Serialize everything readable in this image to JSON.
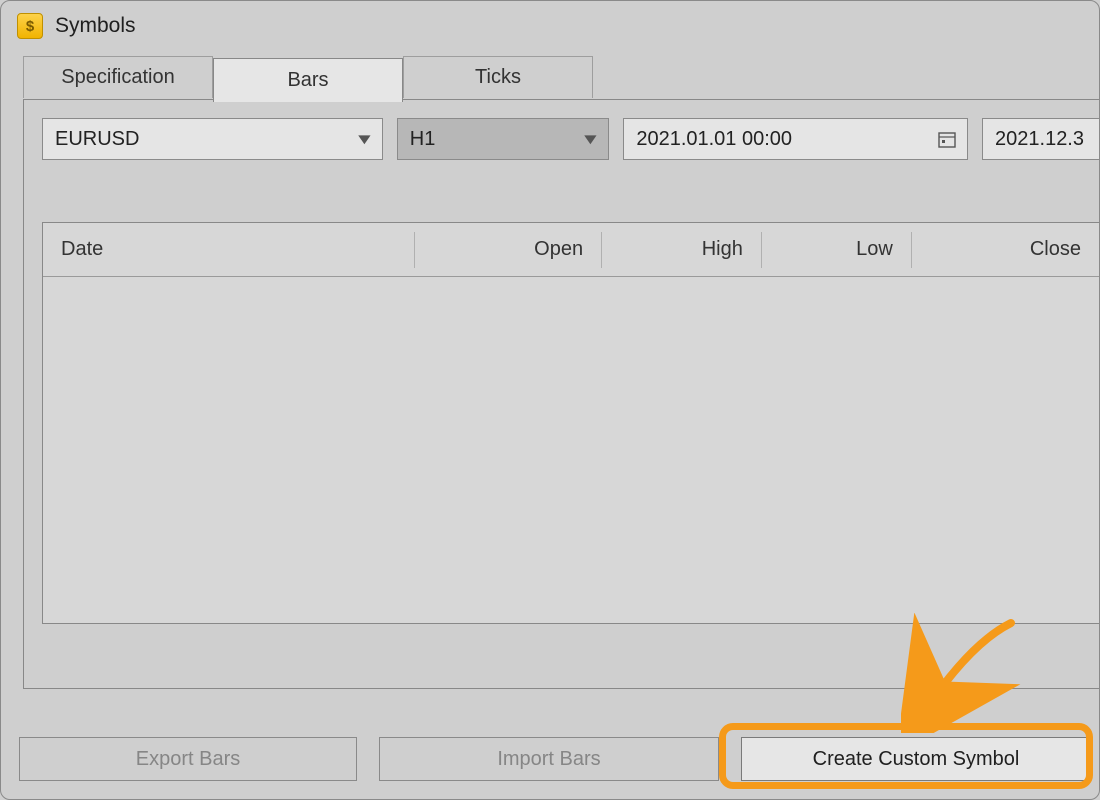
{
  "window": {
    "title": "Symbols"
  },
  "tabs": {
    "items": [
      {
        "label": "Specification"
      },
      {
        "label": "Bars"
      },
      {
        "label": "Ticks"
      }
    ],
    "active_index": 1
  },
  "filters": {
    "symbol": "EURUSD",
    "timeframe": "H1",
    "date_from": "2021.01.01 00:00",
    "date_to_visible": "2021.12.3"
  },
  "grid": {
    "columns": [
      "Date",
      "Open",
      "High",
      "Low",
      "Close"
    ],
    "rows": []
  },
  "buttons": {
    "export": "Export Bars",
    "import": "Import Bars",
    "create": "Create Custom Symbol"
  }
}
